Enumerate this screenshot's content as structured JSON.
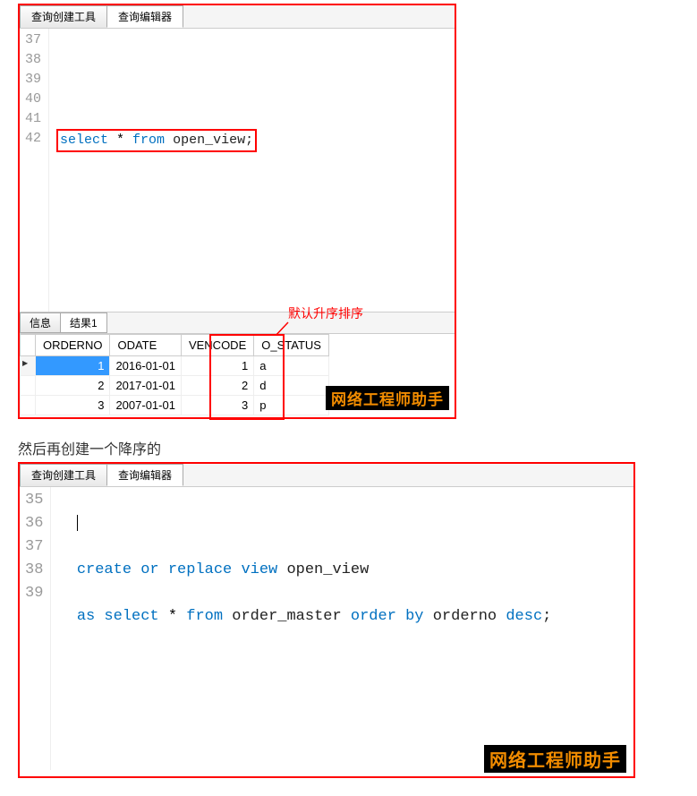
{
  "panel1": {
    "tabs": [
      "查询创建工具",
      "查询编辑器"
    ],
    "activeTab": 1,
    "lines": [
      37,
      38,
      39,
      40,
      41,
      42
    ],
    "code39": {
      "select": "select",
      "star": " * ",
      "from": "from",
      "id": " open_view",
      "semi": ";"
    },
    "annotation": "默认升序排序",
    "subTabs": [
      "信息",
      "结果1"
    ],
    "activeSubTab": 1,
    "columns": [
      "ORDERNO",
      "ODATE",
      "VENCODE",
      "O_STATUS"
    ],
    "rows": [
      {
        "ORDERNO": "1",
        "ODATE": "2016-01-01",
        "VENCODE": "1",
        "O_STATUS": "a"
      },
      {
        "ORDERNO": "2",
        "ODATE": "2017-01-01",
        "VENCODE": "2",
        "O_STATUS": "d"
      },
      {
        "ORDERNO": "3",
        "ODATE": "2007-01-01",
        "VENCODE": "3",
        "O_STATUS": "p"
      }
    ],
    "watermark": "网络工程师助手"
  },
  "betweenText": "然后再创建一个降序的",
  "panel2": {
    "tabs": [
      "查询创建工具",
      "查询编辑器"
    ],
    "activeTab": 1,
    "lines": [
      35,
      36,
      37,
      38,
      39
    ],
    "code36": {
      "p1": "create or replace view",
      "id1": " open_view"
    },
    "code37": {
      "p1": "as select",
      "star": " * ",
      "p2": "from",
      "id2": " order_master ",
      "p3": "order by",
      "id3": " orderno ",
      "p4": "desc",
      "semi": ";"
    },
    "watermark": "网络工程师助手"
  }
}
